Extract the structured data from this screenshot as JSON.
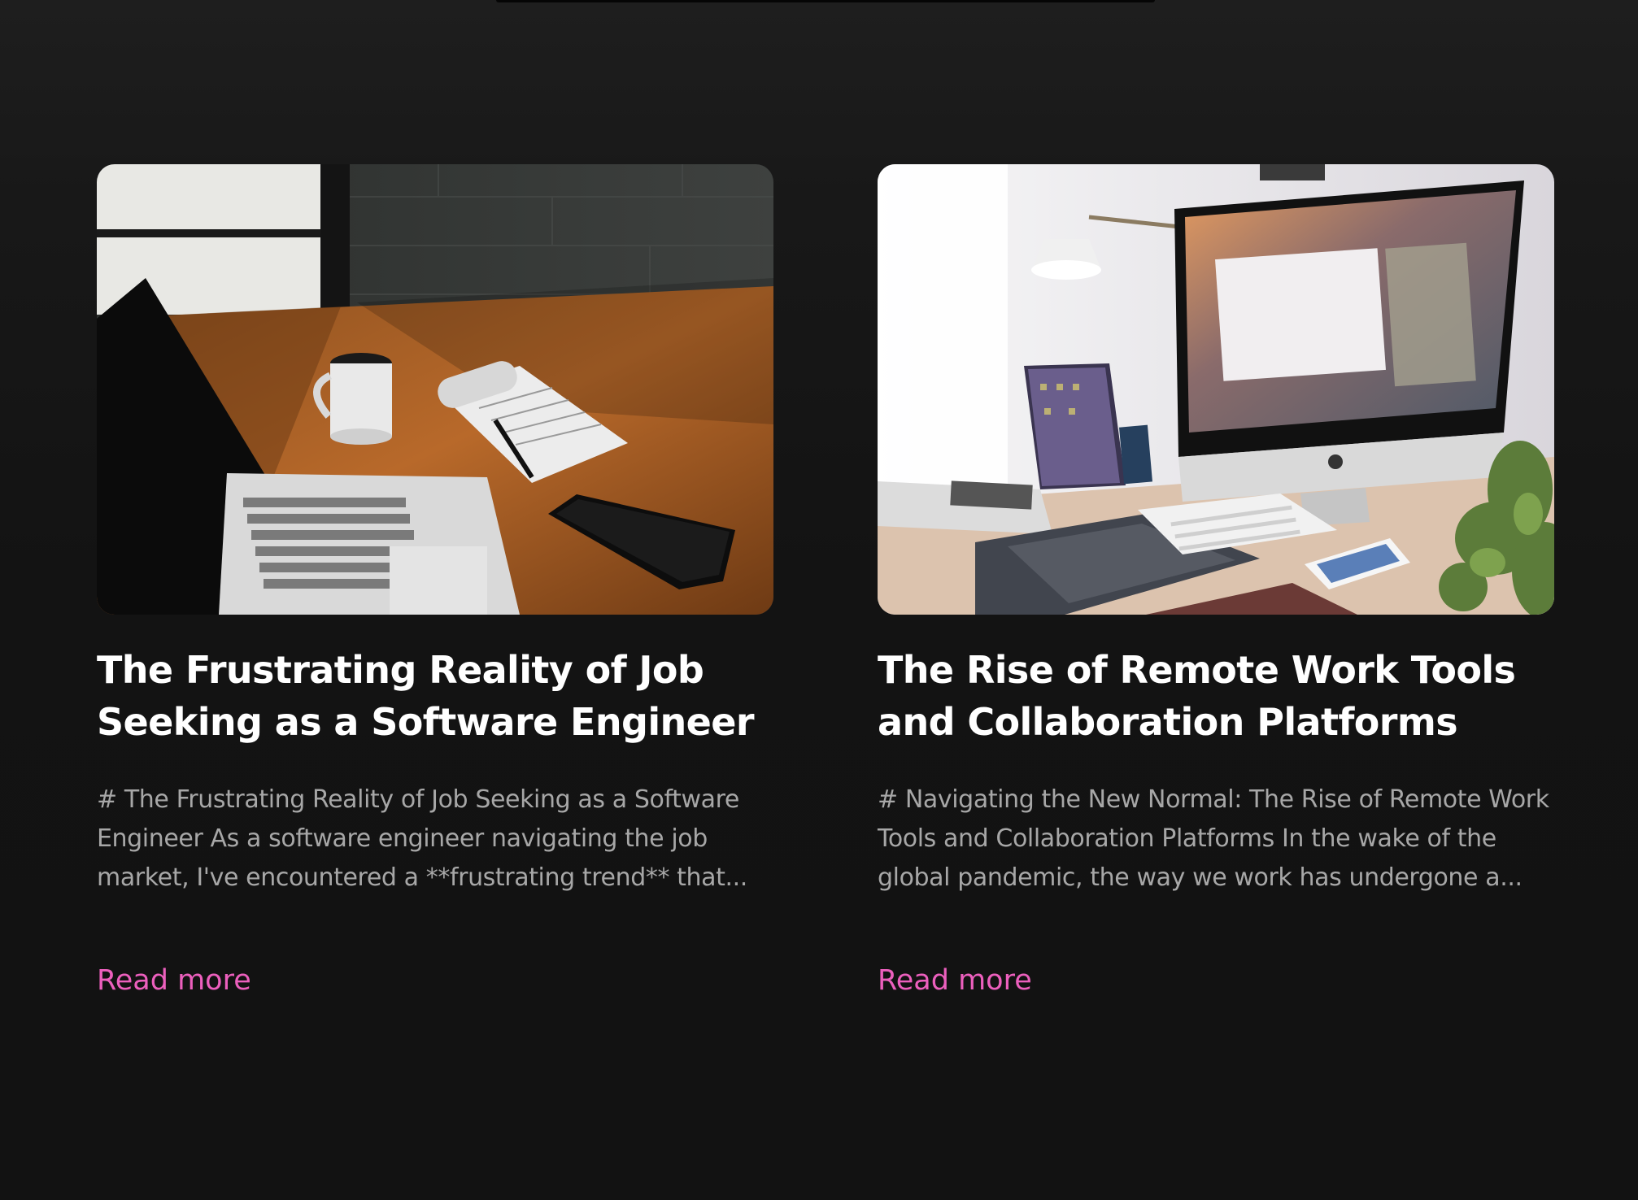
{
  "posts": [
    {
      "title": "The Frustrating Reality of Job Seeking as a Software Engineer",
      "excerpt": "# The Frustrating Reality of Job Seeking as a Software Engineer As a software engineer navigating the job market, I've encountered a **frustrating trend** that...",
      "read_more_label": "Read more",
      "image_subject": "laptop-coffee-notepad-desk-photo"
    },
    {
      "title": "The Rise of Remote Work Tools and Collaboration Platforms",
      "excerpt": "# Navigating the New Normal: The Rise of Remote Work Tools and Collaboration Platforms In the wake of the global pandemic, the way we work has undergone a...",
      "read_more_label": "Read more",
      "image_subject": "imac-laptop-tablet-workspace-photo"
    }
  ],
  "colors": {
    "background": "#121212",
    "title": "#ffffff",
    "excerpt": "#a7a7a7",
    "accent": "#ec5fbd"
  }
}
